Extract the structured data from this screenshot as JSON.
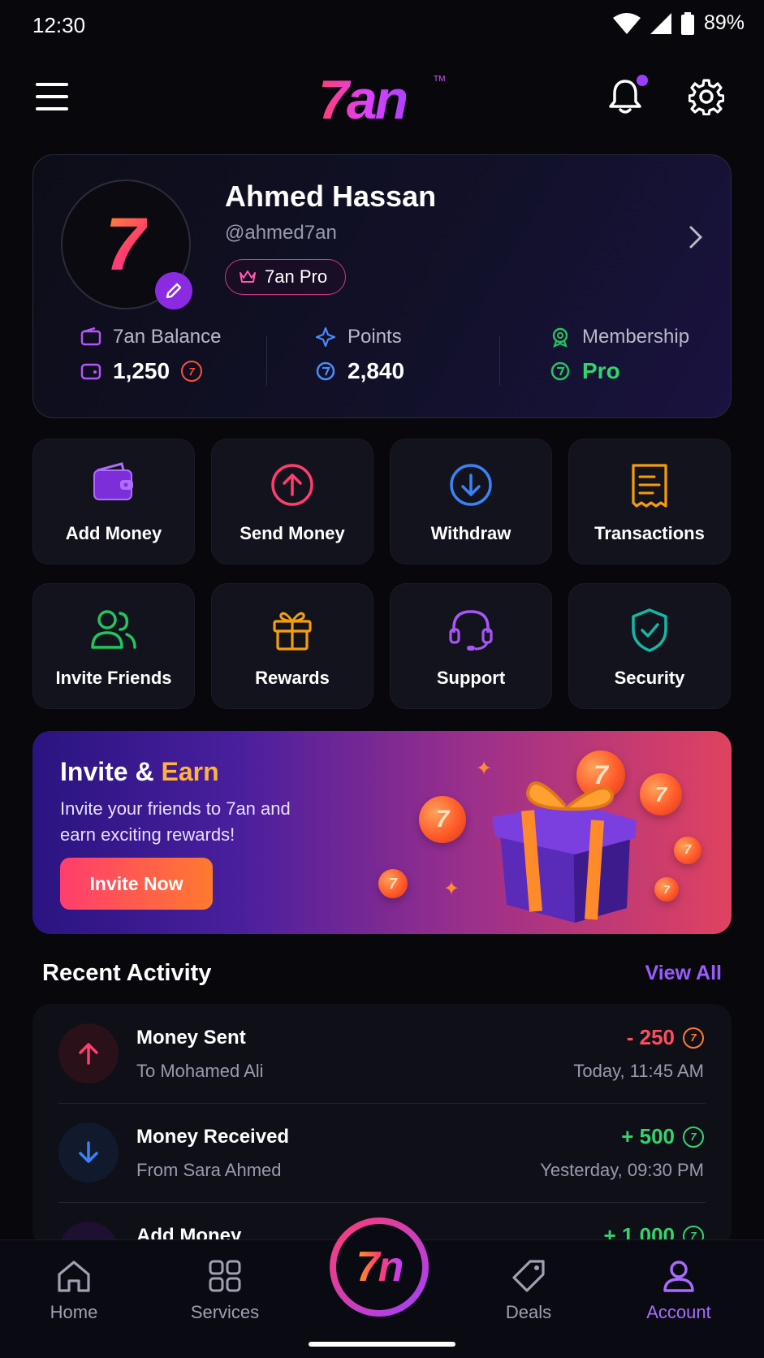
{
  "status_bar": {
    "time": "12:30",
    "battery": "89%"
  },
  "header": {
    "logo": "7an",
    "logo_tm": "TM"
  },
  "profile": {
    "avatar_logo": "7",
    "name": "Ahmed Hassan",
    "handle": "@ahmed7an",
    "tier": "7an Pro",
    "stats": [
      {
        "label": "7an Balance",
        "value": "1,250",
        "coin": "7"
      },
      {
        "label": "Points",
        "value": "2,840"
      },
      {
        "label": "Membership",
        "value": "Pro"
      }
    ]
  },
  "tiles": [
    {
      "label": "Add Money",
      "icon": "wallet-icon",
      "color": "#a855f7"
    },
    {
      "label": "Send Money",
      "icon": "arrow-up-circle-icon",
      "color": "#ff3d6e"
    },
    {
      "label": "Withdraw",
      "icon": "arrow-down-circle-icon",
      "color": "#3b82f6"
    },
    {
      "label": "Transactions",
      "icon": "receipt-icon",
      "color": "#f59e0b"
    },
    {
      "label": "Invite Friends",
      "icon": "users-icon",
      "color": "#22c55e"
    },
    {
      "label": "Rewards",
      "icon": "gift-icon",
      "color": "#f59e0b"
    },
    {
      "label": "Support",
      "icon": "headset-icon",
      "color": "#a855f7"
    },
    {
      "label": "Security",
      "icon": "shield-icon",
      "color": "#14b8a6"
    }
  ],
  "banner": {
    "title_prefix": "Invite & ",
    "title_accent": "Earn",
    "subtitle": "Invite your friends to 7an and earn exciting rewards!",
    "button": "Invite Now",
    "coin_glyph": "7"
  },
  "recent": {
    "title": "Recent Activity",
    "view_all": "View All",
    "items": [
      {
        "title": "Money Sent",
        "subtitle": "To Mohamed Ali",
        "amount": "- 250",
        "coin": "7",
        "date": "Today, 11:45 AM",
        "color": "#ff4d5e"
      },
      {
        "title": "Money Received",
        "subtitle": "From Sara Ahmed",
        "amount": "+ 500",
        "coin": "7",
        "date": "Yesterday, 09:30 PM",
        "color": "#34d36e"
      },
      {
        "title": "Add Money",
        "amount": "+ 1,000",
        "coin": "7",
        "color": "#34d36e"
      }
    ]
  },
  "nav": {
    "items": [
      {
        "label": "Home",
        "icon": "home-icon"
      },
      {
        "label": "Services",
        "icon": "grid-icon"
      },
      {
        "label": "Deals",
        "icon": "tag-icon"
      },
      {
        "label": "Account",
        "icon": "user-icon",
        "active": true
      }
    ],
    "fab_logo": "7n"
  }
}
